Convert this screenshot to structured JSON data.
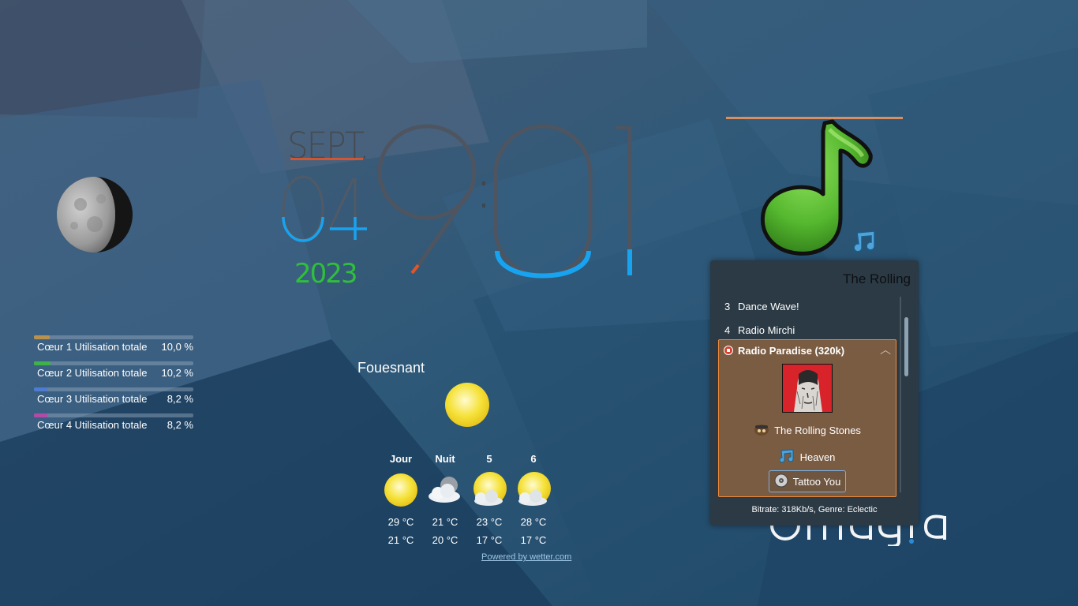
{
  "cpu": [
    {
      "label": "Cœur 1 Utilisation totale",
      "value": "10,0 %",
      "level": 0.1,
      "color": "#b8914f"
    },
    {
      "label": "Cœur 2 Utilisation totale",
      "value": "10,2 %",
      "level": 0.102,
      "color": "#3fb24a"
    },
    {
      "label": "Cœur 3 Utilisation totale",
      "value": "8,2 %",
      "level": 0.082,
      "color": "#4f7bd0"
    },
    {
      "label": "Cœur 4 Utilisation totale",
      "value": "8,2 %",
      "level": 0.082,
      "color": "#b04ba8"
    }
  ],
  "clock": {
    "month": "SEPT.",
    "day": "04",
    "year": "2023",
    "time_digits": [
      "9",
      "0",
      "1"
    ],
    "accent_blue": "#18a3f0",
    "accent_orange": "#e0552a",
    "accent_green": "#2fbf3a"
  },
  "weather": {
    "location": "Fouesnant",
    "columns": [
      {
        "header": "Jour",
        "icon": "sun-icon",
        "high": "29 °C",
        "low": "21 °C"
      },
      {
        "header": "Nuit",
        "icon": "night-cloud-icon",
        "high": "21 °C",
        "low": "20 °C"
      },
      {
        "header": "5",
        "icon": "partly-cloudy-icon",
        "high": "23 °C",
        "low": "17 °C"
      },
      {
        "header": "6",
        "icon": "partly-cloudy-icon",
        "high": "28 °C",
        "low": "17 °C"
      }
    ],
    "powered": "Powered by wetter.com"
  },
  "radio": {
    "title": "The Rolling",
    "list": [
      {
        "num": "3",
        "name": "Dance Wave!"
      },
      {
        "num": "4",
        "name": "Radio Mirchi"
      }
    ],
    "expanded": {
      "title": "Radio Paradise (320k)",
      "artist": "The Rolling Stones",
      "track": "Heaven",
      "album": "Tattoo You"
    },
    "bitrate": "Bitrate: 318Kb/s, Genre: Eclectic"
  },
  "logo": "mageia"
}
